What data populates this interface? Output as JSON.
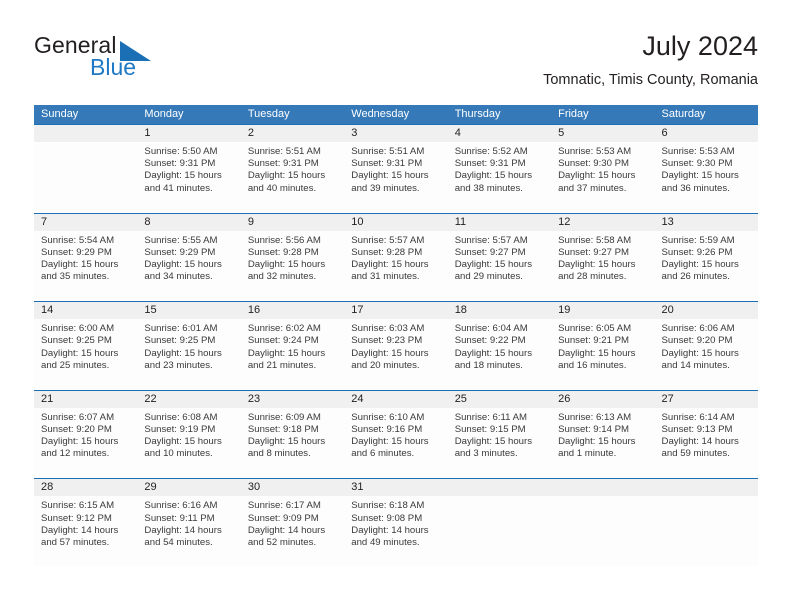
{
  "brand": {
    "name_part1": "General",
    "name_part2": "Blue",
    "accent_color": "#1b6fb5"
  },
  "header": {
    "title": "July 2024",
    "subtitle": "Tomnatic, Timis County, Romania"
  },
  "calendar": {
    "header_bg": "#3579b8",
    "weekdays": [
      "Sunday",
      "Monday",
      "Tuesday",
      "Wednesday",
      "Thursday",
      "Friday",
      "Saturday"
    ],
    "weeks": [
      [
        {
          "day": "",
          "sunrise": "",
          "sunset": "",
          "daylight_line1": "",
          "daylight_line2": ""
        },
        {
          "day": "1",
          "sunrise": "Sunrise: 5:50 AM",
          "sunset": "Sunset: 9:31 PM",
          "daylight_line1": "Daylight: 15 hours",
          "daylight_line2": "and 41 minutes."
        },
        {
          "day": "2",
          "sunrise": "Sunrise: 5:51 AM",
          "sunset": "Sunset: 9:31 PM",
          "daylight_line1": "Daylight: 15 hours",
          "daylight_line2": "and 40 minutes."
        },
        {
          "day": "3",
          "sunrise": "Sunrise: 5:51 AM",
          "sunset": "Sunset: 9:31 PM",
          "daylight_line1": "Daylight: 15 hours",
          "daylight_line2": "and 39 minutes."
        },
        {
          "day": "4",
          "sunrise": "Sunrise: 5:52 AM",
          "sunset": "Sunset: 9:31 PM",
          "daylight_line1": "Daylight: 15 hours",
          "daylight_line2": "and 38 minutes."
        },
        {
          "day": "5",
          "sunrise": "Sunrise: 5:53 AM",
          "sunset": "Sunset: 9:30 PM",
          "daylight_line1": "Daylight: 15 hours",
          "daylight_line2": "and 37 minutes."
        },
        {
          "day": "6",
          "sunrise": "Sunrise: 5:53 AM",
          "sunset": "Sunset: 9:30 PM",
          "daylight_line1": "Daylight: 15 hours",
          "daylight_line2": "and 36 minutes."
        }
      ],
      [
        {
          "day": "7",
          "sunrise": "Sunrise: 5:54 AM",
          "sunset": "Sunset: 9:29 PM",
          "daylight_line1": "Daylight: 15 hours",
          "daylight_line2": "and 35 minutes."
        },
        {
          "day": "8",
          "sunrise": "Sunrise: 5:55 AM",
          "sunset": "Sunset: 9:29 PM",
          "daylight_line1": "Daylight: 15 hours",
          "daylight_line2": "and 34 minutes."
        },
        {
          "day": "9",
          "sunrise": "Sunrise: 5:56 AM",
          "sunset": "Sunset: 9:28 PM",
          "daylight_line1": "Daylight: 15 hours",
          "daylight_line2": "and 32 minutes."
        },
        {
          "day": "10",
          "sunrise": "Sunrise: 5:57 AM",
          "sunset": "Sunset: 9:28 PM",
          "daylight_line1": "Daylight: 15 hours",
          "daylight_line2": "and 31 minutes."
        },
        {
          "day": "11",
          "sunrise": "Sunrise: 5:57 AM",
          "sunset": "Sunset: 9:27 PM",
          "daylight_line1": "Daylight: 15 hours",
          "daylight_line2": "and 29 minutes."
        },
        {
          "day": "12",
          "sunrise": "Sunrise: 5:58 AM",
          "sunset": "Sunset: 9:27 PM",
          "daylight_line1": "Daylight: 15 hours",
          "daylight_line2": "and 28 minutes."
        },
        {
          "day": "13",
          "sunrise": "Sunrise: 5:59 AM",
          "sunset": "Sunset: 9:26 PM",
          "daylight_line1": "Daylight: 15 hours",
          "daylight_line2": "and 26 minutes."
        }
      ],
      [
        {
          "day": "14",
          "sunrise": "Sunrise: 6:00 AM",
          "sunset": "Sunset: 9:25 PM",
          "daylight_line1": "Daylight: 15 hours",
          "daylight_line2": "and 25 minutes."
        },
        {
          "day": "15",
          "sunrise": "Sunrise: 6:01 AM",
          "sunset": "Sunset: 9:25 PM",
          "daylight_line1": "Daylight: 15 hours",
          "daylight_line2": "and 23 minutes."
        },
        {
          "day": "16",
          "sunrise": "Sunrise: 6:02 AM",
          "sunset": "Sunset: 9:24 PM",
          "daylight_line1": "Daylight: 15 hours",
          "daylight_line2": "and 21 minutes."
        },
        {
          "day": "17",
          "sunrise": "Sunrise: 6:03 AM",
          "sunset": "Sunset: 9:23 PM",
          "daylight_line1": "Daylight: 15 hours",
          "daylight_line2": "and 20 minutes."
        },
        {
          "day": "18",
          "sunrise": "Sunrise: 6:04 AM",
          "sunset": "Sunset: 9:22 PM",
          "daylight_line1": "Daylight: 15 hours",
          "daylight_line2": "and 18 minutes."
        },
        {
          "day": "19",
          "sunrise": "Sunrise: 6:05 AM",
          "sunset": "Sunset: 9:21 PM",
          "daylight_line1": "Daylight: 15 hours",
          "daylight_line2": "and 16 minutes."
        },
        {
          "day": "20",
          "sunrise": "Sunrise: 6:06 AM",
          "sunset": "Sunset: 9:20 PM",
          "daylight_line1": "Daylight: 15 hours",
          "daylight_line2": "and 14 minutes."
        }
      ],
      [
        {
          "day": "21",
          "sunrise": "Sunrise: 6:07 AM",
          "sunset": "Sunset: 9:20 PM",
          "daylight_line1": "Daylight: 15 hours",
          "daylight_line2": "and 12 minutes."
        },
        {
          "day": "22",
          "sunrise": "Sunrise: 6:08 AM",
          "sunset": "Sunset: 9:19 PM",
          "daylight_line1": "Daylight: 15 hours",
          "daylight_line2": "and 10 minutes."
        },
        {
          "day": "23",
          "sunrise": "Sunrise: 6:09 AM",
          "sunset": "Sunset: 9:18 PM",
          "daylight_line1": "Daylight: 15 hours",
          "daylight_line2": "and 8 minutes."
        },
        {
          "day": "24",
          "sunrise": "Sunrise: 6:10 AM",
          "sunset": "Sunset: 9:16 PM",
          "daylight_line1": "Daylight: 15 hours",
          "daylight_line2": "and 6 minutes."
        },
        {
          "day": "25",
          "sunrise": "Sunrise: 6:11 AM",
          "sunset": "Sunset: 9:15 PM",
          "daylight_line1": "Daylight: 15 hours",
          "daylight_line2": "and 3 minutes."
        },
        {
          "day": "26",
          "sunrise": "Sunrise: 6:13 AM",
          "sunset": "Sunset: 9:14 PM",
          "daylight_line1": "Daylight: 15 hours",
          "daylight_line2": "and 1 minute."
        },
        {
          "day": "27",
          "sunrise": "Sunrise: 6:14 AM",
          "sunset": "Sunset: 9:13 PM",
          "daylight_line1": "Daylight: 14 hours",
          "daylight_line2": "and 59 minutes."
        }
      ],
      [
        {
          "day": "28",
          "sunrise": "Sunrise: 6:15 AM",
          "sunset": "Sunset: 9:12 PM",
          "daylight_line1": "Daylight: 14 hours",
          "daylight_line2": "and 57 minutes."
        },
        {
          "day": "29",
          "sunrise": "Sunrise: 6:16 AM",
          "sunset": "Sunset: 9:11 PM",
          "daylight_line1": "Daylight: 14 hours",
          "daylight_line2": "and 54 minutes."
        },
        {
          "day": "30",
          "sunrise": "Sunrise: 6:17 AM",
          "sunset": "Sunset: 9:09 PM",
          "daylight_line1": "Daylight: 14 hours",
          "daylight_line2": "and 52 minutes."
        },
        {
          "day": "31",
          "sunrise": "Sunrise: 6:18 AM",
          "sunset": "Sunset: 9:08 PM",
          "daylight_line1": "Daylight: 14 hours",
          "daylight_line2": "and 49 minutes."
        },
        {
          "day": "",
          "sunrise": "",
          "sunset": "",
          "daylight_line1": "",
          "daylight_line2": ""
        },
        {
          "day": "",
          "sunrise": "",
          "sunset": "",
          "daylight_line1": "",
          "daylight_line2": ""
        },
        {
          "day": "",
          "sunrise": "",
          "sunset": "",
          "daylight_line1": "",
          "daylight_line2": ""
        }
      ]
    ]
  }
}
